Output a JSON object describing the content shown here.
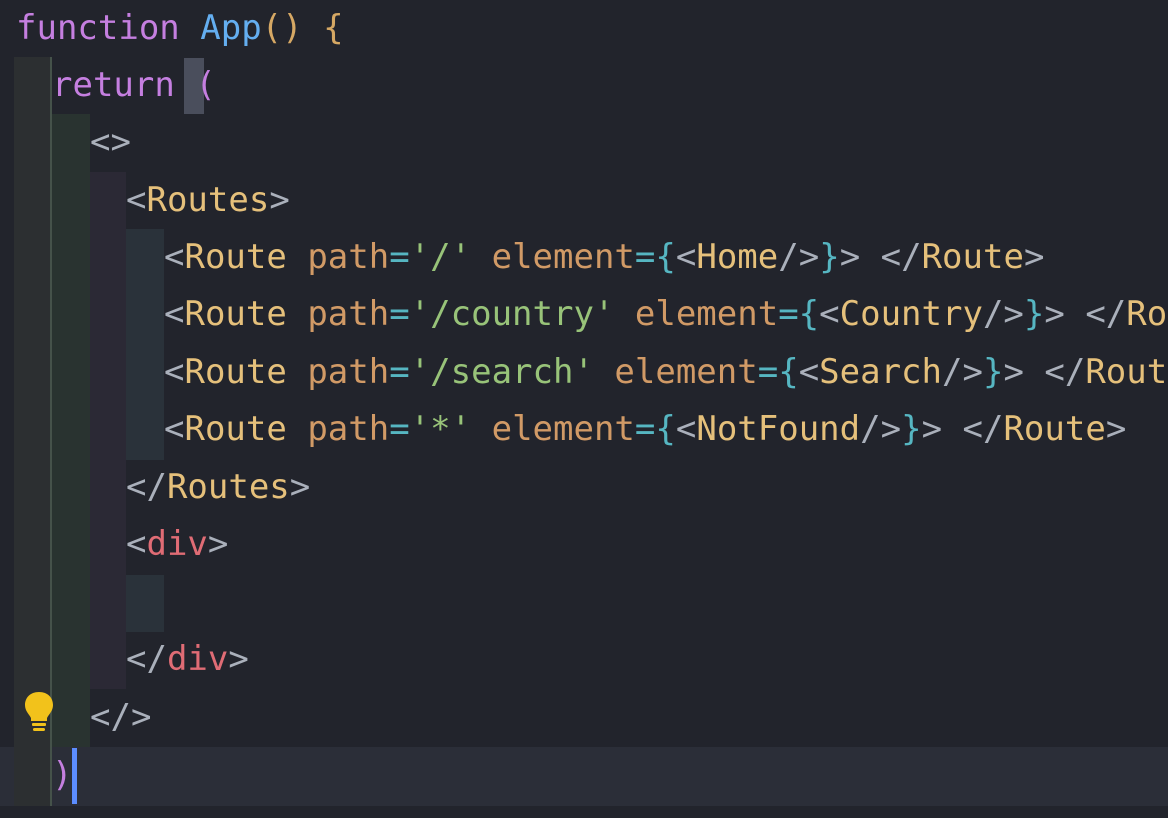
{
  "code": {
    "line1": {
      "keyword": "function",
      "name": "App",
      "parens": "()",
      "brace": "{"
    },
    "line2": {
      "keyword": "return",
      "paren": "("
    },
    "line3": {
      "fragment_open": "<>"
    },
    "line4": {
      "open": "<",
      "tag": "Routes",
      "close": ">"
    },
    "routes": [
      {
        "path": "'/'",
        "component": "Home"
      },
      {
        "path": "'/country'",
        "component": "Country"
      },
      {
        "path": "'/search'",
        "component": "Search"
      },
      {
        "path": "'*'",
        "component": "NotFound"
      }
    ],
    "route_tag": "Route",
    "attr_path": "path",
    "attr_element": "element",
    "line9": {
      "open": "</",
      "tag": "Routes",
      "close": ">"
    },
    "line10": {
      "open": "<",
      "tag": "div",
      "close": ">"
    },
    "line12": {
      "open": "</",
      "tag": "div",
      "close": ">"
    },
    "line13": {
      "fragment_close": "</>"
    },
    "line14": {
      "paren": ")"
    }
  },
  "icons": {
    "bulb": "lightbulb-icon"
  },
  "colors": {
    "background": "#22242c",
    "keyword": "#c57fe0",
    "function": "#64aef0",
    "tag": "#e5c07b",
    "html_tag": "#e06c75",
    "attribute": "#d19a66",
    "string": "#98c379",
    "operator": "#56b6c2",
    "cursor": "#5c8dff"
  }
}
